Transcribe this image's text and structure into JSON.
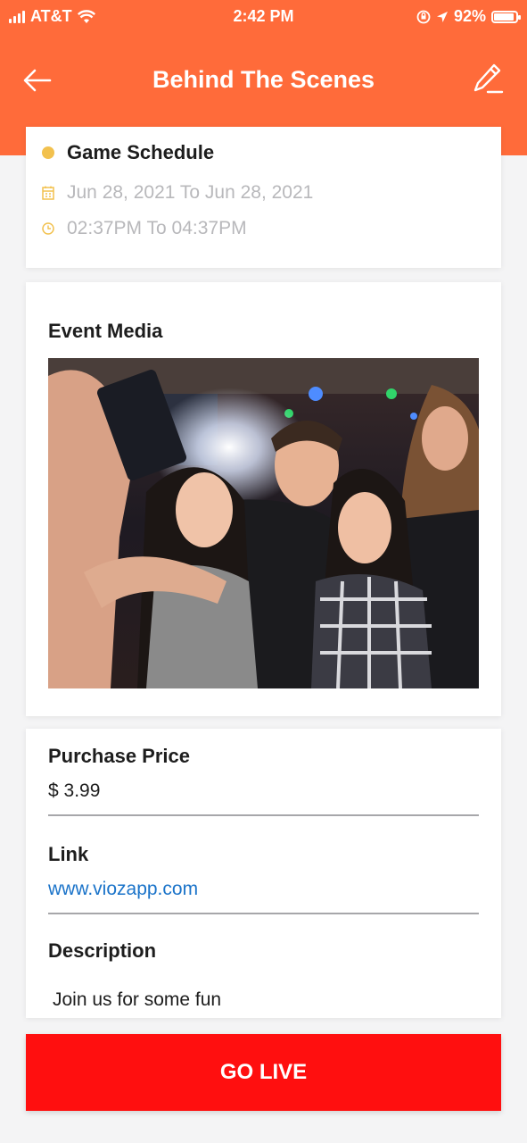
{
  "status_bar": {
    "carrier": "AT&T",
    "time": "2:42 PM",
    "battery": "92%",
    "battery_level": 0.92,
    "icons": [
      "signal-icon",
      "wifi-icon",
      "orientation-lock-icon",
      "location-arrow-icon",
      "battery-icon"
    ]
  },
  "header": {
    "title": "Behind The Scenes",
    "background_color": "#ff6b3a",
    "back_icon": "back-arrow-icon",
    "edit_icon": "pencil-icon"
  },
  "schedule": {
    "title": "Game Schedule",
    "date_range": "Jun 28, 2021 To Jun 28, 2021",
    "time_range": "02:37PM To 04:37PM",
    "dot_color": "#f2c14e",
    "icons": [
      "calendar-icon",
      "clock-icon"
    ]
  },
  "media": {
    "label": "Event Media",
    "image_alt_icon": "event-photo"
  },
  "details": {
    "price_label": "Purchase Price",
    "price_value": "$ 3.99",
    "link_label": "Link",
    "link_value": "www.viozapp.com",
    "description_label": "Description",
    "description_value": "Join us for some fun"
  },
  "actions": {
    "go_live_label": "GO LIVE",
    "go_live_color": "#ff0f0f"
  }
}
